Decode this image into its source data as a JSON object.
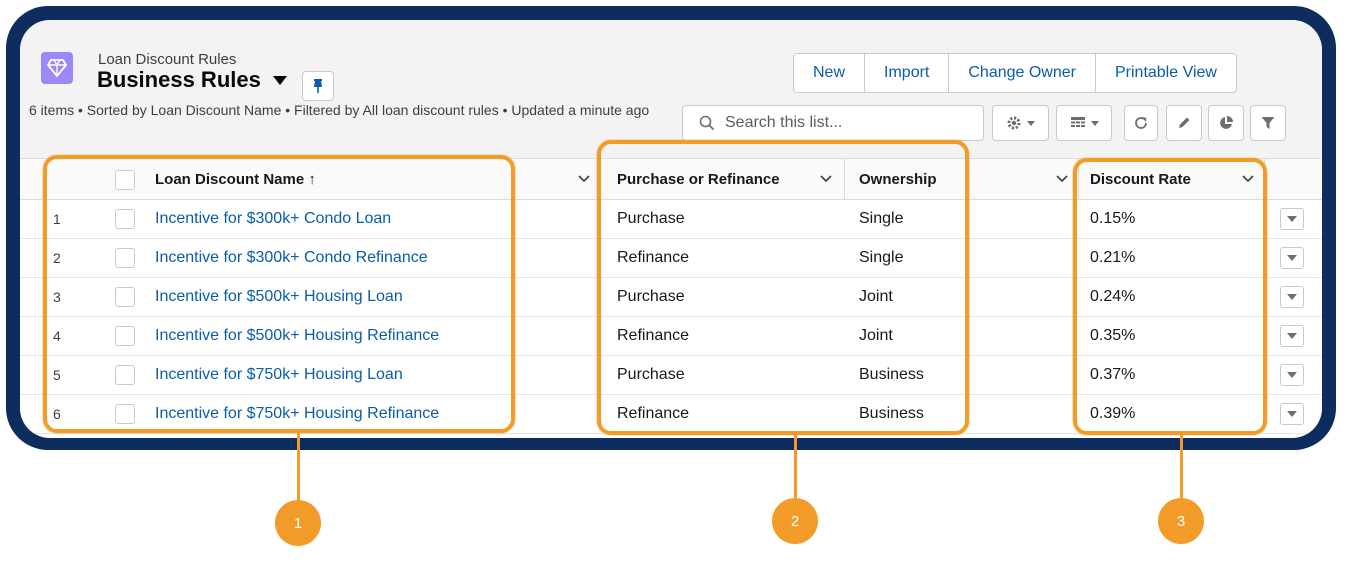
{
  "header": {
    "object_label": "Loan Discount Rules",
    "list_title": "Business Rules",
    "meta": "6 items • Sorted by Loan Discount Name • Filtered by All loan discount rules • Updated a minute ago",
    "buttons": [
      "New",
      "Import",
      "Change Owner",
      "Printable View"
    ],
    "search_placeholder": "Search this list..."
  },
  "table": {
    "columns": [
      "Loan Discount Name ↑",
      "Purchase or Refinance",
      "Ownership",
      "Discount Rate"
    ],
    "rows": [
      {
        "num": "1",
        "name": "Incentive for $300k+ Condo Loan",
        "type": "Purchase",
        "ownership": "Single",
        "rate": "0.15%"
      },
      {
        "num": "2",
        "name": "Incentive for $300k+ Condo Refinance",
        "type": "Refinance",
        "ownership": "Single",
        "rate": "0.21%"
      },
      {
        "num": "3",
        "name": "Incentive for $500k+ Housing Loan",
        "type": "Purchase",
        "ownership": "Joint",
        "rate": "0.24%"
      },
      {
        "num": "4",
        "name": "Incentive for $500k+ Housing Refinance",
        "type": "Refinance",
        "ownership": "Joint",
        "rate": "0.35%"
      },
      {
        "num": "5",
        "name": "Incentive for $750k+ Housing Loan",
        "type": "Purchase",
        "ownership": "Business",
        "rate": "0.37%"
      },
      {
        "num": "6",
        "name": "Incentive for $750k+ Housing Refinance",
        "type": "Refinance",
        "ownership": "Business",
        "rate": "0.39%"
      }
    ]
  },
  "callouts": [
    "1",
    "2",
    "3"
  ],
  "colors": {
    "frame": "#0d2d5e",
    "highlight": "#f39b28",
    "link": "#0b5cab",
    "object_icon": "#9e87f7"
  },
  "icons": {
    "object": "diamond-icon",
    "pin": "pin-icon",
    "search": "search-icon",
    "settings": "gear-icon",
    "display": "table-icon",
    "refresh": "refresh-icon",
    "edit": "pencil-icon",
    "chart": "pie-chart-icon",
    "filter": "filter-icon"
  }
}
